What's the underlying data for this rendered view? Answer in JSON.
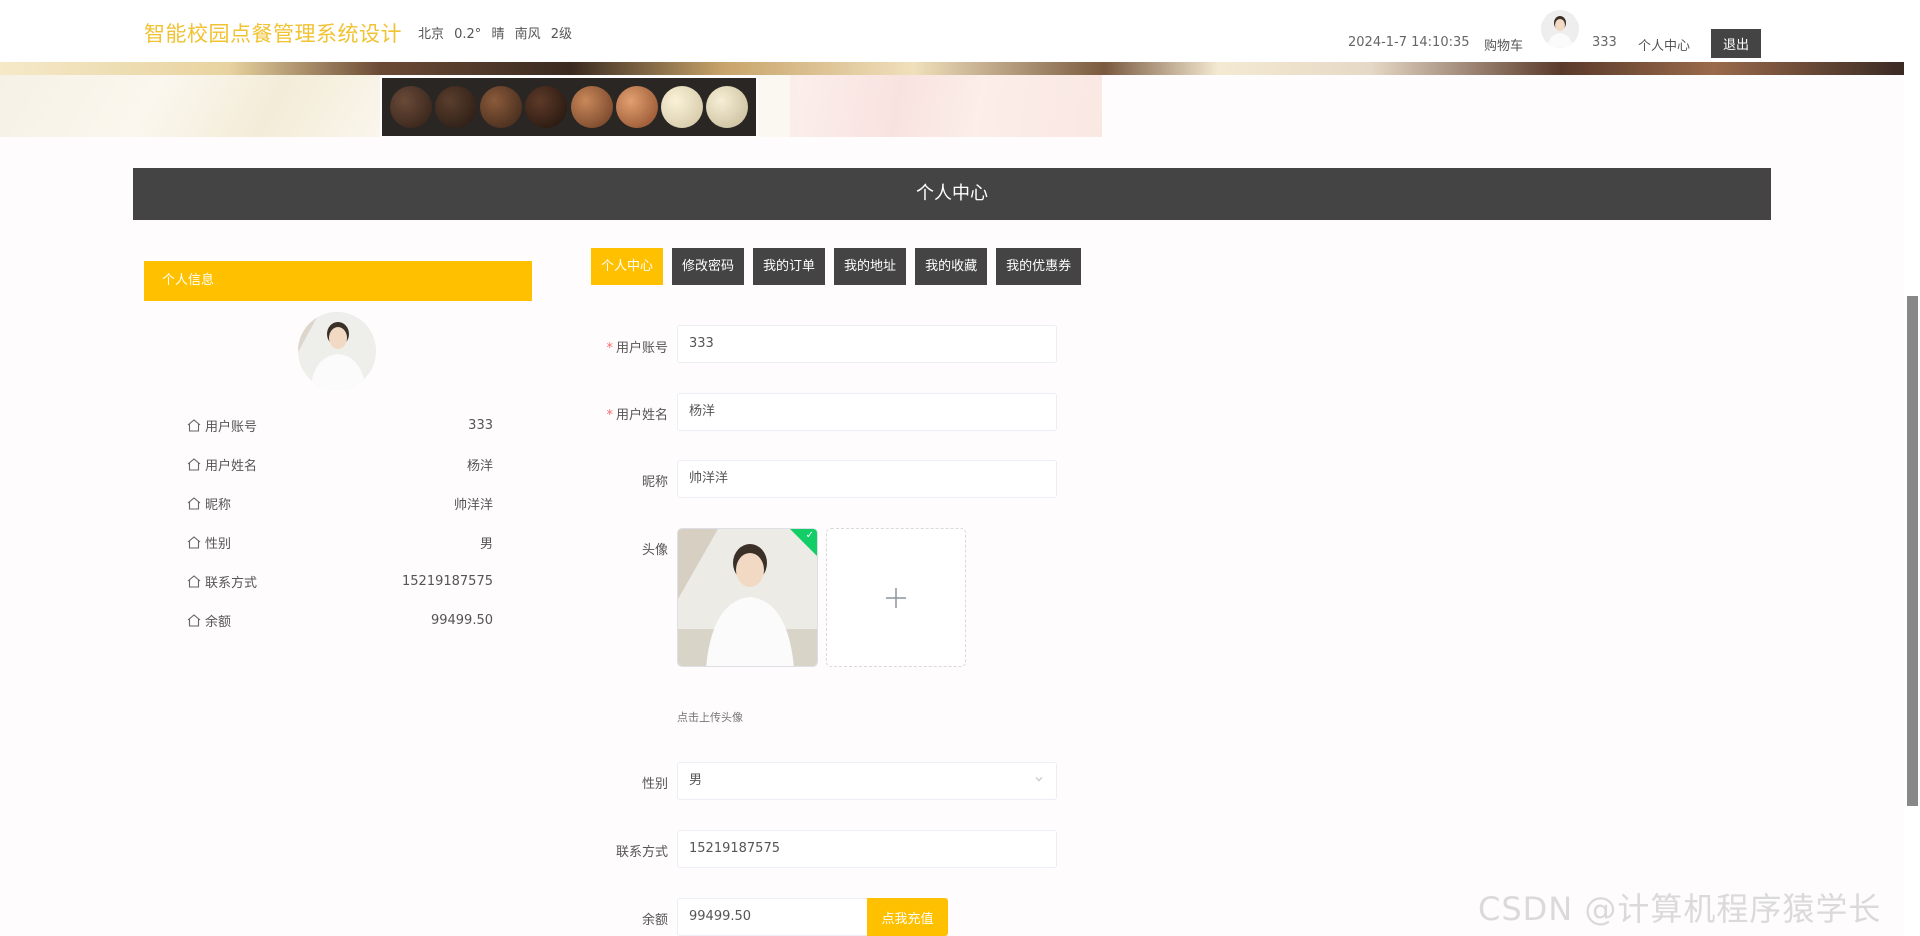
{
  "header": {
    "site_title": "智能校园点餐管理系统设计",
    "weather": "北京 0.2° 晴 南风 2级",
    "datetime": "2024-1-7 14:10:35",
    "cart": "购物车",
    "username": "333",
    "center": "个人中心",
    "logout": "退出"
  },
  "section_title": "个人中心",
  "sidebar": {
    "heading": "个人信息",
    "rows": [
      {
        "label": "用户账号",
        "value": "333"
      },
      {
        "label": "用户姓名",
        "value": "杨洋"
      },
      {
        "label": "昵称",
        "value": "帅洋洋"
      },
      {
        "label": "性别",
        "value": "男"
      },
      {
        "label": "联系方式",
        "value": "15219187575"
      },
      {
        "label": "余额",
        "value": "99499.50"
      }
    ]
  },
  "tabs": [
    {
      "label": "个人中心",
      "active": true
    },
    {
      "label": "修改密码",
      "active": false
    },
    {
      "label": "我的订单",
      "active": false
    },
    {
      "label": "我的地址",
      "active": false
    },
    {
      "label": "我的收藏",
      "active": false
    },
    {
      "label": "我的优惠券",
      "active": false
    }
  ],
  "form": {
    "account_label": "用户账号",
    "account_value": "333",
    "name_label": "用户姓名",
    "name_value": "杨洋",
    "nickname_label": "昵称",
    "nickname_value": "帅洋洋",
    "avatar_label": "头像",
    "upload_tip": "点击上传头像",
    "gender_label": "性别",
    "gender_value": "男",
    "phone_label": "联系方式",
    "phone_value": "15219187575",
    "balance_label": "余额",
    "balance_value": "99499.50",
    "recharge_label": "点我充值"
  },
  "watermark": "CSDN @计算机程序猿学长",
  "colors": {
    "accent": "#ffc000",
    "title": "#f1c232",
    "dark": "#444444",
    "success": "#13ce66"
  }
}
